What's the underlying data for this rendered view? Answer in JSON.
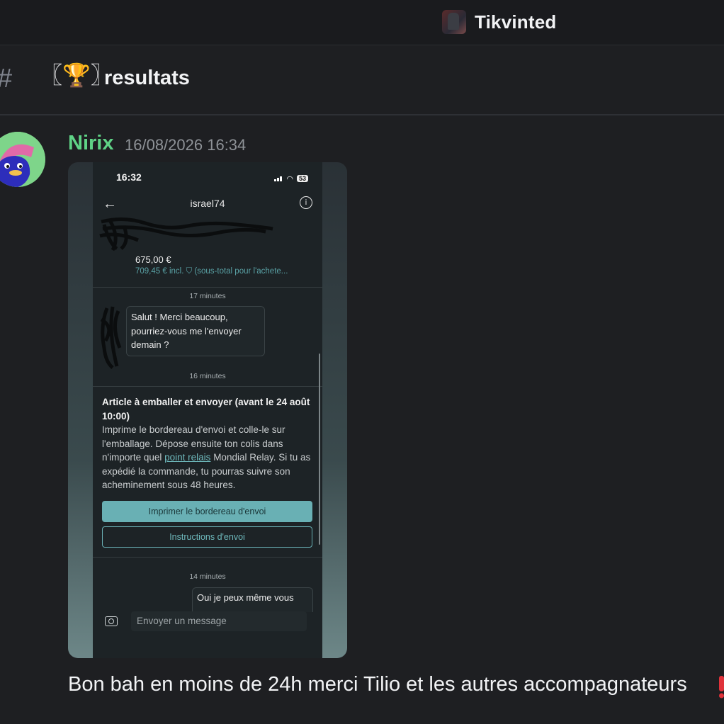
{
  "server": {
    "name": "Tikvinted",
    "icon": "server-avatar-icon"
  },
  "channel": {
    "prefix": "#",
    "emoji": "〖🏆〗",
    "name": "resultats"
  },
  "message": {
    "author": "Nirix",
    "author_color": "#5fd386",
    "timestamp": "16/08/2026 16:34",
    "text": "Bon bah en moins de 24h merci Tilio et les autres accompagnateurs",
    "attachment": {
      "status_time": "16:32",
      "battery": "53",
      "username": "israel74",
      "item_price": "675,00 €",
      "item_incl": "709,45 € incl. ⛉ (sous-total pour l'achete...",
      "time_1": "17 minutes",
      "bubble_1": "Salut ! Merci beaucoup, pourriez-vous me l'envoyer demain ?",
      "time_2": "16 minutes",
      "card_title": "Article à emballer et envoyer (avant le 24 août 10:00)",
      "card_body_before": "Imprime le bordereau d'envoi et colle-le sur l'emballage. Dépose ensuite ton colis dans n'importe quel ",
      "card_link": "point relais",
      "card_body_after": " Mondial Relay. Si tu as expédié la commande, tu pourras suivre son acheminement sous 48 heures.",
      "btn_print": "Imprimer le bordereau d'envoi",
      "btn_instructions": "Instructions d'envoi",
      "time_3": "14 minutes",
      "bubble_2": "Oui je peux même vous",
      "compose_placeholder": "Envoyer un message"
    }
  },
  "colors": {
    "background": "#1e1f22",
    "accent": "#69b0b4"
  }
}
